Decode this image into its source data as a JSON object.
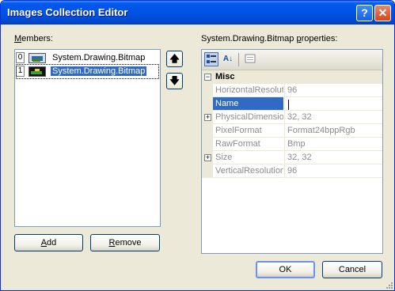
{
  "window": {
    "title": "Images Collection Editor",
    "help_glyph": "?",
    "close_glyph": "✕"
  },
  "members": {
    "label_key": "M",
    "label_rest": "embers:",
    "items": [
      {
        "index": "0",
        "text": "System.Drawing.Bitmap",
        "selected": false
      },
      {
        "index": "1",
        "text": "System.Drawing.Bitmap",
        "selected": true
      }
    ]
  },
  "buttons": {
    "add_key": "A",
    "add_rest": "dd",
    "remove_key": "R",
    "remove_rest": "emove",
    "move_up_glyph": "🡅",
    "move_down_glyph": "🡇",
    "ok": "OK",
    "cancel": "Cancel"
  },
  "properties": {
    "label_pre": "System.Drawing.Bitmap ",
    "label_key": "p",
    "label_rest": "roperties:",
    "toolbar": {
      "categorized_icon": "categorized-icon",
      "alphabetical_icon": "alphabetical-icon",
      "property_pages_icon": "property-pages-icon",
      "alpha_glyph": "A↓"
    },
    "category": "Misc",
    "rows": [
      {
        "name": "HorizontalResolution",
        "value": "96",
        "expandable": false,
        "selected": false
      },
      {
        "name": "Name",
        "value": "",
        "expandable": false,
        "selected": true
      },
      {
        "name": "PhysicalDimension",
        "value": "32, 32",
        "expandable": true,
        "selected": false
      },
      {
        "name": "PixelFormat",
        "value": "Format24bppRgb",
        "expandable": false,
        "selected": false
      },
      {
        "name": "RawFormat",
        "value": "Bmp",
        "expandable": false,
        "selected": false
      },
      {
        "name": "Size",
        "value": "32, 32",
        "expandable": true,
        "selected": false
      },
      {
        "name": "VerticalResolution",
        "value": "96",
        "expandable": false,
        "selected": false
      }
    ]
  }
}
